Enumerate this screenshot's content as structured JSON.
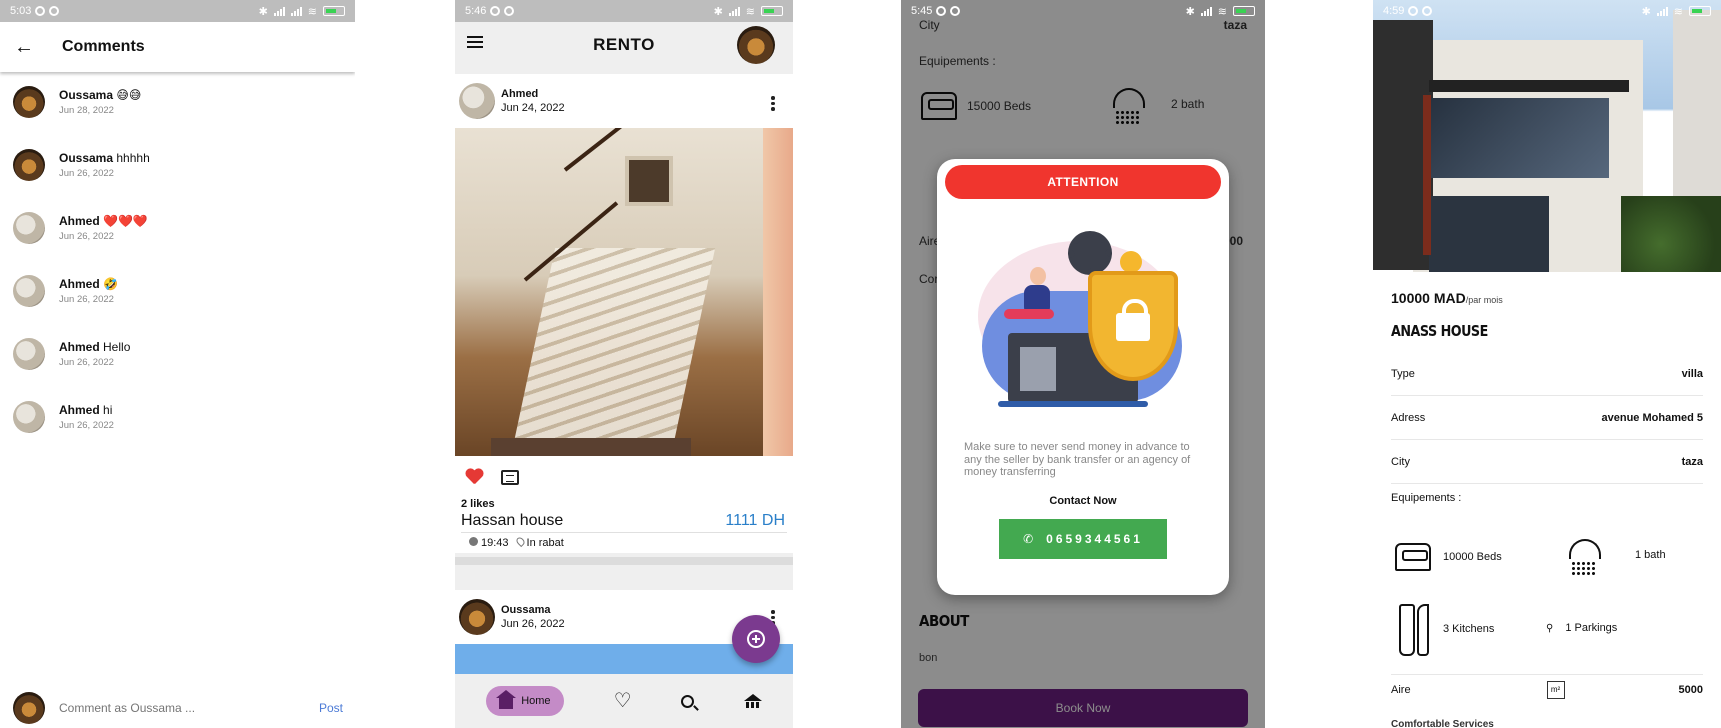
{
  "phone1": {
    "status_time": "5:03",
    "title": "Comments",
    "comments": [
      {
        "name": "Oussama",
        "text": "😅😅",
        "date": "Jun 28, 2022",
        "avatar": "oussama"
      },
      {
        "name": "Oussama",
        "text": "hhhhh",
        "date": "Jun 26, 2022",
        "avatar": "oussama"
      },
      {
        "name": "Ahmed",
        "text": "❤️❤️❤️",
        "date": "Jun 26, 2022",
        "avatar": "ahmed"
      },
      {
        "name": "Ahmed",
        "text": "🤣",
        "date": "Jun 26, 2022",
        "avatar": "ahmed"
      },
      {
        "name": "Ahmed",
        "text": "Hello",
        "date": "Jun 26, 2022",
        "avatar": "ahmed"
      },
      {
        "name": "Ahmed",
        "text": "hi",
        "date": "Jun 26, 2022",
        "avatar": "ahmed"
      }
    ],
    "input_placeholder": "Comment as Oussama ...",
    "post_label": "Post"
  },
  "phone2": {
    "status_time": "5:46",
    "brand": "RENTO",
    "post1": {
      "author": "Ahmed",
      "date": "Jun 24, 2022",
      "likes": "2 likes",
      "title": "Hassan house",
      "price": "1111 DH",
      "time": "19:43",
      "location": "In rabat"
    },
    "post2": {
      "author": "Oussama",
      "date": "Jun 26, 2022"
    },
    "nav": {
      "home_label": "Home"
    }
  },
  "phone3": {
    "status_time": "5:45",
    "bg_city_label": "City",
    "bg_city_value": "taza",
    "bg_equipements": "Equipements :",
    "bg_beds": "15000 Beds",
    "bg_bath": "2 bath",
    "bg_aire": "Aire",
    "bg_aire_value": "000",
    "bg_co": "Cor",
    "attention": "ATTENTION",
    "message": "Make sure to never send money in advance to any the seller by bank transfer or an agency of money transferring",
    "contact_label": "Contact Now",
    "phone_number": "0659344561",
    "about_title": "ABOUT",
    "about_text": "bon",
    "book_label": "Book Now"
  },
  "phone4": {
    "status_time": "4:59",
    "price": "10000 MAD",
    "price_suffix": "/par mois",
    "name": "ANASS HOUSE",
    "details": [
      {
        "label": "Type",
        "value": "villa"
      },
      {
        "label": "Adress",
        "value": "avenue Mohamed 5"
      },
      {
        "label": "City",
        "value": "taza"
      }
    ],
    "equipements_label": "Equipements :",
    "beds": "10000 Beds",
    "bath": "1 bath",
    "kitchens": "3 Kitchens",
    "parkings": "1 Parkings",
    "aire_label": "Aire",
    "aire_unit": "m²",
    "aire_value": "5000",
    "services_label": "Comfortable Services"
  }
}
